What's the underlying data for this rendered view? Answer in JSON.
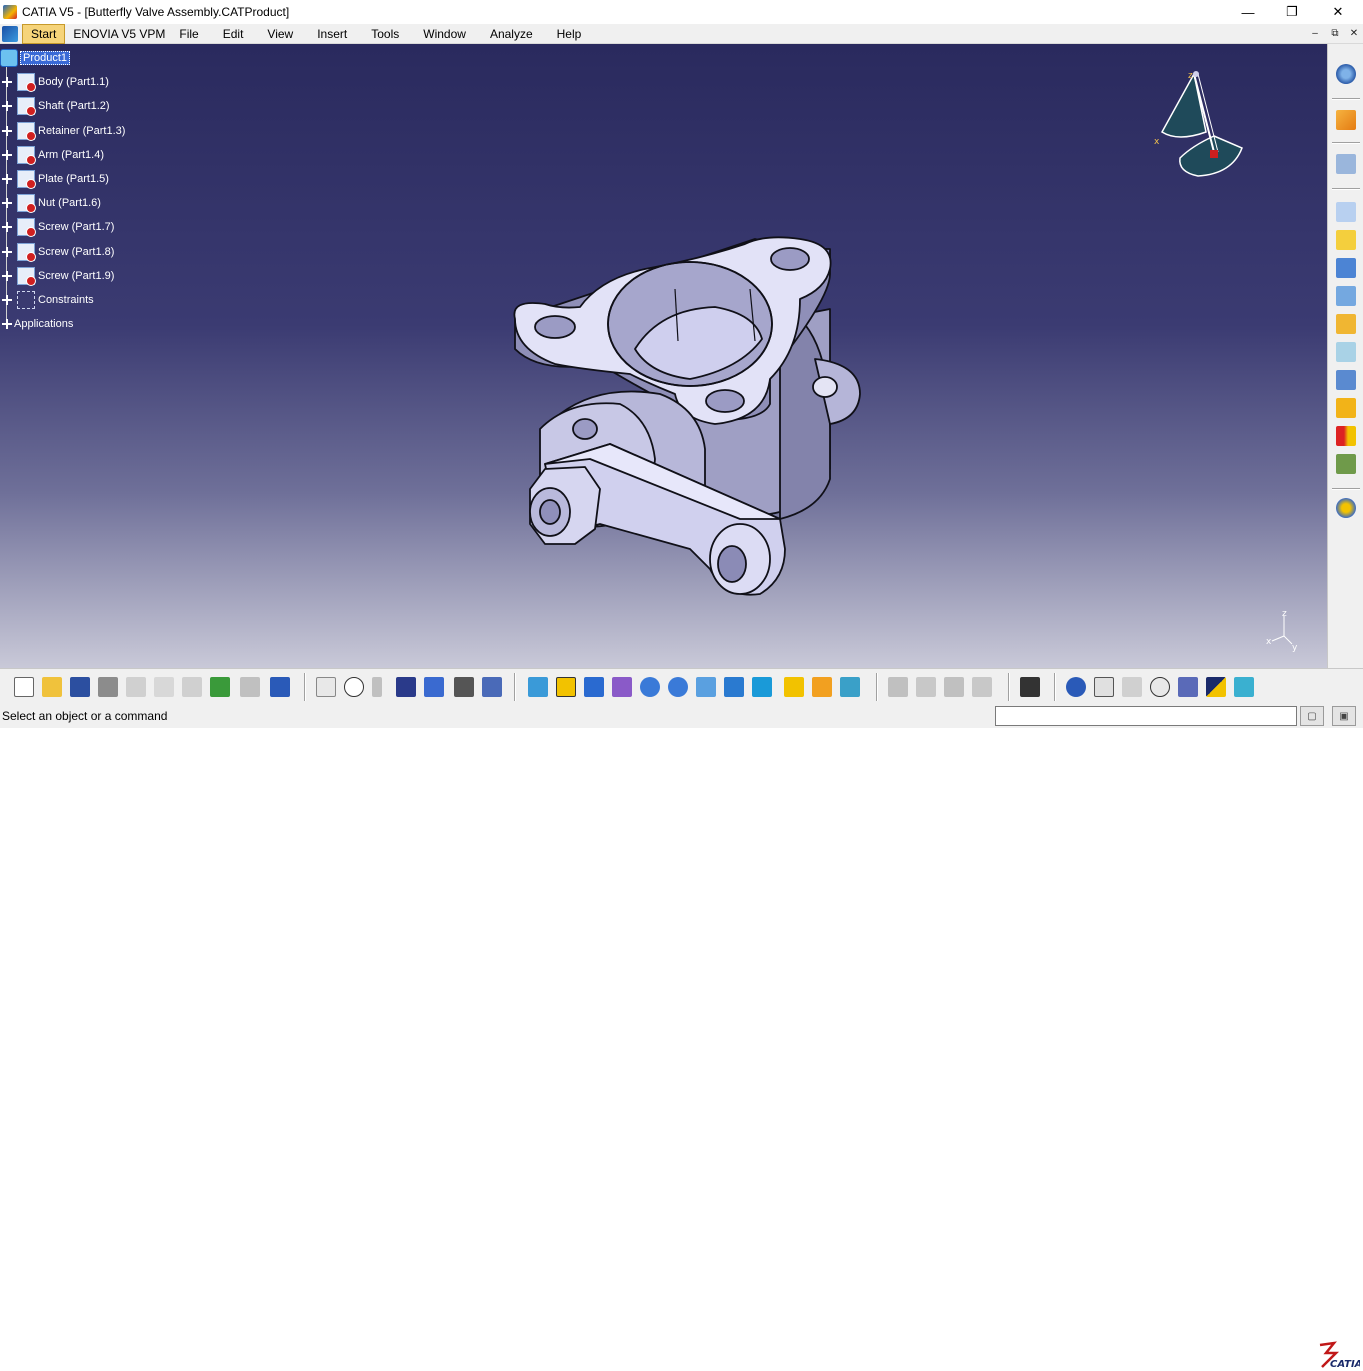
{
  "window": {
    "title": "CATIA V5 - [Butterfly Valve Assembly.CATProduct]",
    "controls": {
      "minimize": "—",
      "maximize": "❐",
      "close": "✕"
    },
    "mdi_controls": {
      "minimize": "–",
      "restore": "⧉",
      "close": "✕"
    }
  },
  "menubar": {
    "items": [
      "Start",
      "ENOVIA V5 VPM",
      "File",
      "Edit",
      "View",
      "Insert",
      "Tools",
      "Window",
      "Analyze",
      "Help"
    ],
    "active": "Start"
  },
  "tree": {
    "root": "Product1",
    "parts": [
      "Body (Part1.1)",
      "Shaft (Part1.2)",
      "Retainer (Part1.3)",
      "Arm (Part1.4)",
      "Plate (Part1.5)",
      "Nut (Part1.6)",
      "Screw (Part1.7)",
      "Screw (Part1.8)",
      "Screw (Part1.9)"
    ],
    "constraints": "Constraints",
    "applications": "Applications"
  },
  "compass": {
    "z_label": "z",
    "x_label": "x"
  },
  "axis_triad": {
    "z": "z",
    "x": "x",
    "y": "y"
  },
  "right_toolbar": {
    "icons": [
      "product-structure-icon",
      "select-icon",
      "snap-icon",
      "catalog-browser-icon",
      "existing-component-icon",
      "manipulation-icon",
      "snap-component-icon",
      "explode-icon",
      "clash-icon",
      "coincidence-constraint-icon",
      "contact-constraint-icon",
      "offset-constraint-icon",
      "angle-constraint-icon",
      "fix-component-icon",
      "reuse-pattern-icon",
      "measure-icon"
    ]
  },
  "bottom_toolbar": {
    "icons": [
      "new-icon",
      "open-icon",
      "save-icon",
      "print-icon",
      "cut-icon",
      "copy-icon",
      "paste-icon",
      "undo-icon",
      "redo-icon",
      "whats-this-icon",
      "formula-icon",
      "comment-icon",
      "knowledge-icon",
      "table-icon",
      "graph-tree-icon",
      "lock-icon",
      "tree-expand-icon",
      "fly-mode-icon",
      "fit-all-icon",
      "pan-icon",
      "rotate-icon",
      "zoom-in-icon",
      "zoom-out-icon",
      "normal-view-icon",
      "multi-view-icon",
      "iso-view-icon",
      "hide-show-icon",
      "swap-visible-icon",
      "shading-icon",
      "sketcher-icon",
      "measure-between-icon",
      "constraint-analysis-icon",
      "update-icon",
      "capture-icon",
      "target-icon",
      "previous-view-icon",
      "next-view-icon",
      "search-icon",
      "material-icon",
      "apply-material-icon",
      "scene-icon"
    ]
  },
  "status": {
    "message": "Select an object or a command",
    "command_value": ""
  },
  "brand": {
    "logo_text": "CATIA"
  }
}
